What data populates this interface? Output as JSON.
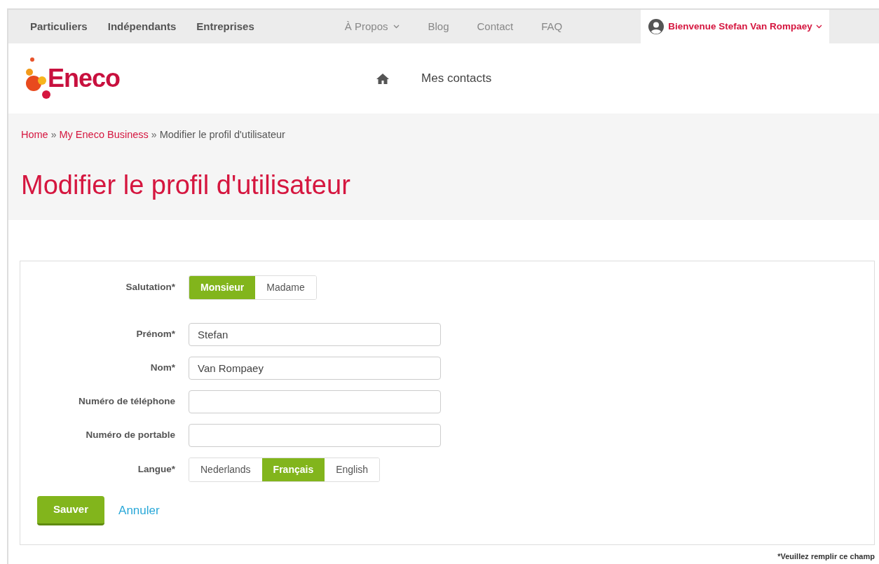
{
  "top_nav": {
    "items": [
      {
        "label": "Particuliers",
        "kind": "segment"
      },
      {
        "label": "Indépendants",
        "kind": "segment"
      },
      {
        "label": "Entreprises",
        "kind": "segment"
      },
      {
        "label": "À Propos",
        "kind": "dropdown"
      },
      {
        "label": "Blog",
        "kind": "link"
      },
      {
        "label": "Contact",
        "kind": "link"
      },
      {
        "label": "FAQ",
        "kind": "link"
      }
    ],
    "user": {
      "label": "Bienvenue Stefan Van Rompaey"
    }
  },
  "header": {
    "logo": "Eneco",
    "nav": [
      {
        "kind": "home"
      },
      {
        "kind": "link",
        "label": "Mes contacts"
      }
    ]
  },
  "breadcrumb": [
    {
      "label": "Home",
      "kind": "link"
    },
    {
      "label": "»",
      "kind": "separator"
    },
    {
      "label": "My Eneco Business",
      "kind": "link"
    },
    {
      "label": "»",
      "kind": "separator"
    },
    {
      "label": "Modifier le profil d'utilisateur",
      "kind": "current"
    }
  ],
  "title": "Modifier le profil d'utilisateur",
  "form": {
    "fields": [
      {
        "label": "Salutation*",
        "kind": "choice",
        "options": [
          {
            "label": "Monsieur",
            "selected": true
          },
          {
            "label": "Madame",
            "selected": false
          }
        ]
      },
      {
        "label": "Prénom*",
        "kind": "text",
        "value": "Stefan"
      },
      {
        "label": "Nom*",
        "kind": "text",
        "value": "Van Rompaey"
      },
      {
        "label": "Numéro de téléphone",
        "kind": "text"
      },
      {
        "label": "Numéro de portable",
        "kind": "text"
      },
      {
        "label": "Langue*",
        "kind": "choice",
        "options": [
          {
            "label": "Nederlands",
            "selected": false
          },
          {
            "label": "Français",
            "selected": true
          },
          {
            "label": "English",
            "selected": false
          }
        ]
      }
    ],
    "save": "Sauver",
    "cancel": "Annuler"
  },
  "note": "*Veuillez remplir ce champ"
}
